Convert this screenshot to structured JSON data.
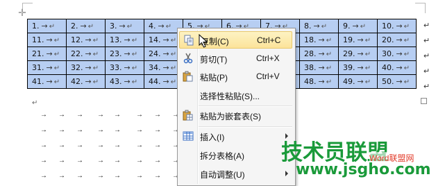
{
  "document": {
    "move_handle_glyph": "✛",
    "arrow_glyph": "→",
    "return_glyph": "↵",
    "paragraph_mark": "↵",
    "table_rows": [
      [
        "1.",
        "2.",
        "3.",
        "4.",
        "5.",
        "6.",
        "7.",
        "8.",
        "9.",
        "10."
      ],
      [
        "11.",
        "12.",
        "13.",
        "14.",
        "15.",
        "16.",
        "17.",
        "18.",
        "19.",
        "20."
      ],
      [
        "21.",
        "22.",
        "23.",
        "24.",
        "25.",
        "26.",
        "27.",
        "28.",
        "29.",
        "30."
      ],
      [
        "31.",
        "32.",
        "33.",
        "34.",
        "35.",
        "36.",
        "37.",
        "38.",
        "39.",
        "40."
      ],
      [
        "41.",
        "42.",
        "43.",
        "44.",
        "45.",
        "46.",
        "47.",
        "48.",
        "49.",
        "50."
      ]
    ],
    "selection_color": "#b7cef2"
  },
  "context_menu": {
    "items": [
      {
        "label": "复制(C)",
        "shortcut": "Ctrl+C",
        "icon": "copy-icon",
        "highlighted": true
      },
      {
        "label": "剪切(T)",
        "shortcut": "Ctrl+X",
        "icon": "scissors-icon"
      },
      {
        "label": "粘贴(P)",
        "shortcut": "Ctrl+V",
        "icon": "paste-icon"
      },
      {
        "label": "选择性粘贴(S)...",
        "shortcut": "",
        "icon": ""
      },
      {
        "label": "粘贴为嵌套表(S)",
        "shortcut": "",
        "icon": "paste-nested-table-icon"
      },
      {
        "label": "插入(I)",
        "shortcut": "",
        "icon": "insert-table-icon",
        "submenu": true
      },
      {
        "label": "拆分表格(A)",
        "shortcut": "",
        "icon": ""
      },
      {
        "label": "自动调整(U)",
        "shortcut": "",
        "icon": "",
        "submenu": true
      }
    ],
    "highlight_color": "#fce39a"
  },
  "watermark": {
    "title": "技术员联盟",
    "red_text": "Word联盟网",
    "url": "www.jsgho.com"
  }
}
